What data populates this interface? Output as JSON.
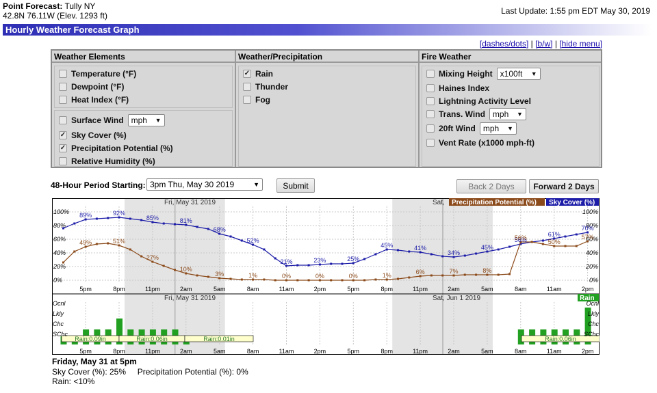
{
  "header": {
    "title_label": "Point Forecast:",
    "location": "Tully NY",
    "coords": "42.8N 76.11W (Elev. 1293 ft)",
    "last_update": "Last Update: 1:55 pm EDT May 30, 2019",
    "page_title": "Hourly Weather Forecast Graph"
  },
  "links": {
    "dashes": "[dashes/dots]",
    "bw": "[b/w]",
    "hide": "[hide menu]",
    "sep": "|"
  },
  "menu": {
    "weather_elements": {
      "header": "Weather Elements",
      "items": [
        {
          "label": "Temperature (°F)",
          "checked": false
        },
        {
          "label": "Dewpoint (°F)",
          "checked": false
        },
        {
          "label": "Heat Index (°F)",
          "checked": false
        },
        {
          "label": "Surface Wind",
          "checked": false,
          "unit": "mph"
        },
        {
          "label": "Sky Cover (%)",
          "checked": true
        },
        {
          "label": "Precipitation Potential (%)",
          "checked": true
        },
        {
          "label": "Relative Humidity (%)",
          "checked": false
        }
      ]
    },
    "weather_precip": {
      "header": "Weather/Precipitation",
      "items": [
        {
          "label": "Rain",
          "checked": true
        },
        {
          "label": "Thunder",
          "checked": false
        },
        {
          "label": "Fog",
          "checked": false
        }
      ]
    },
    "fire_weather": {
      "header": "Fire Weather",
      "items": [
        {
          "label": "Mixing Height",
          "checked": false,
          "unit": "x100ft"
        },
        {
          "label": "Haines Index",
          "checked": false
        },
        {
          "label": "Lightning Activity Level",
          "checked": false
        },
        {
          "label": "Trans. Wind",
          "checked": false,
          "unit": "mph"
        },
        {
          "label": "20ft Wind",
          "checked": false,
          "unit": "mph"
        },
        {
          "label": "Vent Rate (x1000 mph-ft)",
          "checked": false
        }
      ]
    }
  },
  "controls": {
    "period_label": "48-Hour Period Starting:",
    "period_value": "3pm Thu, May 30 2019",
    "submit": "Submit",
    "back": "Back 2 Days",
    "forward": "Forward 2 Days"
  },
  "graph": {
    "day_labels": [
      "Fri, May 31 2019",
      "Sat,"
    ],
    "day_labels_bottom": [
      "Fri, May 31 2019",
      "Sat, Jun 1 2019"
    ],
    "legend_precip": "Precipitation Potential (%)",
    "legend_sky": "Sky Cover (%)",
    "legend_rain": "Rain",
    "y_ticks": [
      "100%",
      "80%",
      "60%",
      "40%",
      "20%",
      "0%"
    ],
    "x_ticks": [
      "5pm",
      "8pm",
      "11pm",
      "2am",
      "5am",
      "8am",
      "11am",
      "2pm",
      "5pm",
      "8pm",
      "11pm",
      "2am",
      "5am",
      "8am",
      "11am",
      "2pm"
    ],
    "rain_levels": [
      "Ocnl",
      "Lkly",
      "Chc",
      "SChc"
    ],
    "rain_levels_right": [
      "Ocnl",
      "Lkly",
      "Chc",
      "SChc"
    ],
    "rain_totals": [
      "Rain:0.09in",
      "Rain:0.06in",
      "Rain:0.01in",
      "Rain:0.06in"
    ]
  },
  "chart_data": {
    "type": "line",
    "x": [
      "3pm",
      "4pm",
      "5pm",
      "6pm",
      "7pm",
      "8pm",
      "9pm",
      "10pm",
      "11pm",
      "12am",
      "1am",
      "2am",
      "3am",
      "4am",
      "5am",
      "6am",
      "7am",
      "8am",
      "9am",
      "10am",
      "11am",
      "12pm",
      "1pm",
      "2pm",
      "3pm",
      "4pm",
      "5pm",
      "6pm",
      "7pm",
      "8pm",
      "9pm",
      "10pm",
      "11pm",
      "12am",
      "1am",
      "2am",
      "3am",
      "4am",
      "5am",
      "6am",
      "7am",
      "8am",
      "9am",
      "10am",
      "11am",
      "12pm",
      "1pm",
      "2pm"
    ],
    "series": [
      {
        "name": "Sky Cover (%)",
        "color": "#1c1ca8",
        "values": [
          76,
          83,
          89,
          90,
          91,
          92,
          90,
          88,
          85,
          83,
          82,
          81,
          78,
          75,
          68,
          64,
          58,
          52,
          45,
          32,
          21,
          22,
          22,
          23,
          24,
          24,
          25,
          31,
          38,
          45,
          44,
          42,
          41,
          38,
          35,
          34,
          36,
          39,
          42,
          45,
          49,
          53,
          56,
          58,
          61,
          64,
          67,
          70
        ],
        "labels": {
          "2": "89%",
          "5": "92%",
          "8": "85%",
          "11": "81%",
          "14": "68%",
          "17": "52%",
          "20": "21%",
          "23": "23%",
          "26": "25%",
          "29": "45%",
          "32": "41%",
          "35": "34%",
          "38": "45%",
          "41": "56%",
          "44": "61%",
          "47": "70%"
        }
      },
      {
        "name": "Precipitation Potential (%)",
        "color": "#8b4a1a",
        "values": [
          26,
          42,
          49,
          53,
          54,
          51,
          45,
          35,
          27,
          21,
          15,
          10,
          7,
          5,
          3,
          2,
          1,
          1,
          1,
          0,
          0,
          0,
          0,
          0,
          0,
          0,
          0,
          0,
          1,
          1,
          2,
          4,
          6,
          7,
          7,
          7,
          8,
          8,
          8,
          8,
          9,
          56,
          56,
          53,
          50,
          50,
          50,
          57
        ],
        "labels": {
          "2": "49%",
          "5": "51%",
          "8": "27%",
          "11": "10%",
          "14": "3%",
          "17": "1%",
          "20": "0%",
          "23": "0%",
          "26": "0%",
          "29": "1%",
          "32": "6%",
          "35": "7%",
          "38": "8%",
          "41": "56%",
          "44": "50%",
          "47": "57%"
        }
      },
      {
        "name": "Rain",
        "color": "#22a021",
        "levels": [
          "SChc",
          "SChc",
          "Chc",
          "Chc",
          "Chc",
          "Lkly",
          "Chc",
          "Chc",
          "Chc",
          "Chc",
          "Chc",
          "SChc",
          "",
          "",
          "",
          "",
          "",
          "",
          "",
          "",
          "",
          "",
          "",
          "",
          "",
          "",
          "",
          "",
          "",
          "",
          "",
          "",
          "",
          "",
          "",
          "",
          "",
          "",
          "",
          "",
          "",
          "Chc",
          "Chc",
          "Chc",
          "Chc",
          "Chc",
          "Chc",
          "Ocnl"
        ]
      }
    ],
    "ylim": [
      0,
      100
    ],
    "grid": true,
    "legend": "top-right"
  },
  "detail": {
    "date": "Friday, May 31 at 5pm",
    "line1": "Sky Cover (%): 25%     Precipitation Potential (%): 0%",
    "line2": "Rain: <10%"
  }
}
